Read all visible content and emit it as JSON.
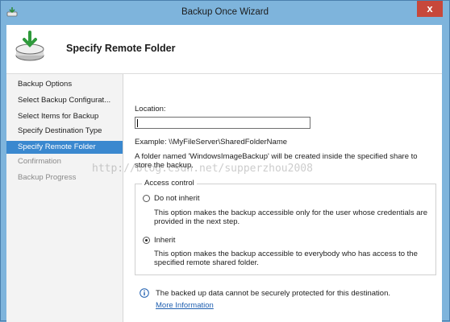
{
  "window": {
    "title": "Backup Once Wizard",
    "close_glyph": "x"
  },
  "header": {
    "page_title": "Specify Remote Folder"
  },
  "nav": {
    "items": [
      {
        "label": "Backup Options",
        "state": "normal"
      },
      {
        "label": "Select Backup Configurat...",
        "state": "normal"
      },
      {
        "label": "Select Items for Backup",
        "state": "normal"
      },
      {
        "label": "Specify Destination Type",
        "state": "normal"
      },
      {
        "label": "Specify Remote Folder",
        "state": "active"
      },
      {
        "label": "Confirmation",
        "state": "disabled"
      },
      {
        "label": "Backup Progress",
        "state": "disabled"
      }
    ]
  },
  "location": {
    "label": "Location:",
    "value": "",
    "example": "Example: \\\\MyFileServer\\SharedFolderName",
    "note_line1": "A folder named 'WindowsImageBackup' will be created inside the specified share to",
    "note_line2": "store the backup."
  },
  "access_control": {
    "title": "Access control",
    "do_not_inherit": {
      "label": "Do not inherit",
      "desc_line1": "This option makes the backup accessible only for the user whose credentials are",
      "desc_line2": "provided in the next step."
    },
    "inherit": {
      "label": "Inherit",
      "desc_line1": "This option makes the backup accessible to everybody who has access to the",
      "desc_line2": "specified remote shared folder."
    },
    "selected": "inherit"
  },
  "info": {
    "text": "The backed up data cannot be securely protected for this destination.",
    "link": "More Information"
  },
  "watermark": "http://blog.csdn.net/supperzhou2008",
  "colors": {
    "accent": "#3a88cf",
    "link": "#1f5fb0",
    "frame": "#7eb4dc",
    "close": "#c7483b"
  }
}
